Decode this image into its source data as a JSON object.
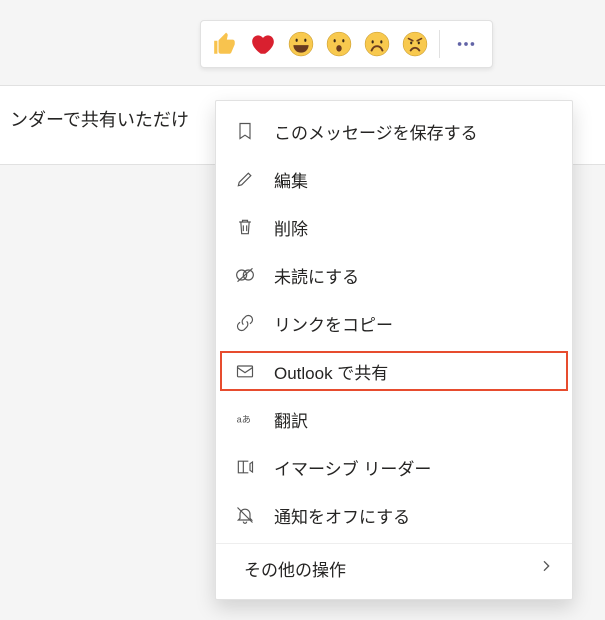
{
  "message": {
    "visible_text": "ンダーで共有いただけ"
  },
  "reactions": {
    "thumbs_up": "thumbs-up",
    "heart": "heart",
    "laugh": "laugh",
    "surprised": "surprised",
    "sad": "sad",
    "angry": "angry"
  },
  "menu": {
    "save": "このメッセージを保存する",
    "edit": "編集",
    "delete": "削除",
    "unread": "未読にする",
    "copy_link": "リンクをコピー",
    "share_outlook": "Outlook で共有",
    "translate": "翻訳",
    "immersive_reader": "イマーシブ リーダー",
    "turn_off_notify": "通知をオフにする",
    "more_actions": "その他の操作"
  }
}
